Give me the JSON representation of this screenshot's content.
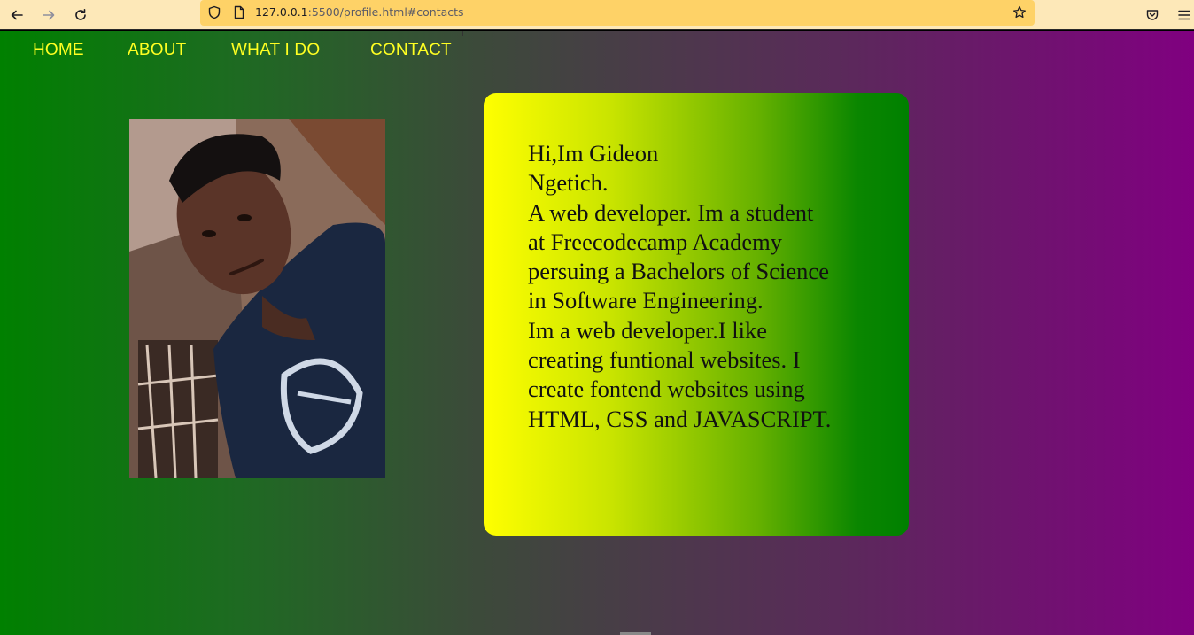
{
  "browser": {
    "back_icon": "arrow-left-icon",
    "forward_icon": "arrow-right-icon",
    "reload_icon": "reload-icon",
    "shield_icon": "shield-icon",
    "page_icon": "page-icon",
    "url_host": "127.0.0.1",
    "url_rest": ":5500/profile.html#contacts",
    "bookmark_icon": "star-icon",
    "pocket_icon": "pocket-icon",
    "menu_icon": "hamburger-menu-icon"
  },
  "nav": {
    "items": [
      {
        "label": "HOME"
      },
      {
        "label": "ABOUT"
      },
      {
        "label": "WHAT I DO"
      },
      {
        "label": "CONTACT"
      }
    ],
    "text_color": "#ffff22"
  },
  "profile": {
    "photo": "profile-photo"
  },
  "card": {
    "lines": [
      "Hi,Im Gideon",
      "Ngetich.",
      "A web developer. Im a student",
      "at Freecodecamp Academy",
      "persuing a Bachelors of Science",
      "in Software Engineering.",
      "Im a web developer.I like",
      "creating funtional websites. I",
      "create fontend websites using",
      "HTML, CSS and JAVASCRIPT."
    ]
  },
  "colors": {
    "page_gradient_start": "#008000",
    "page_gradient_end": "#800080",
    "card_gradient_start": "#ffff00",
    "card_gradient_end": "#008000"
  }
}
